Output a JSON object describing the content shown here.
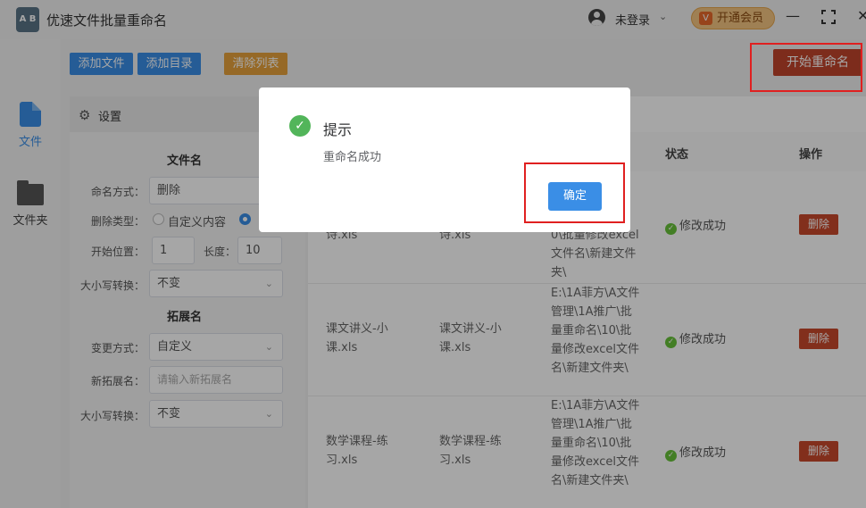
{
  "app": {
    "logo_text": "A B",
    "title": "优速文件批量重命名"
  },
  "header": {
    "user_label": "未登录",
    "user_chevron": "⌄",
    "vip_label": "开通会员",
    "vip_icon_glyph": "V",
    "minimize_glyph": "—",
    "close_glyph": "✕"
  },
  "nav": {
    "files_label": "文件",
    "folders_label": "文件夹"
  },
  "toolbar": {
    "add_file": "添加文件",
    "add_dir": "添加目录",
    "clear_list": "清除列表",
    "start_rename": "开始重命名"
  },
  "settings": {
    "title": "设置",
    "gear_glyph": "⚙",
    "filename_section": "文件名",
    "naming_mode_label": "命名方式：",
    "naming_mode_value": "删除",
    "delete_type_label": "删除类型：",
    "delete_type_option1": "自定义内容",
    "start_pos_label": "开始位置：",
    "start_pos_value": "1",
    "length_label": "长度：",
    "length_value": "10",
    "case_label": "大小写转换：",
    "case_value": "不变",
    "ext_section": "拓展名",
    "change_mode_label": "变更方式：",
    "change_mode_value": "自定义",
    "new_ext_label": "新拓展名：",
    "new_ext_placeholder": "请输入新拓展名",
    "ext_case_label": "大小写转换：",
    "ext_case_value": "不变"
  },
  "table": {
    "columns": {
      "status": "状态",
      "action": "操作"
    },
    "rows": [
      {
        "original_name": "诗.xls",
        "new_name": "诗.xls",
        "path": "0\\批量修改excel文件名\\新建文件夹\\",
        "status": "修改成功",
        "action": "删除"
      },
      {
        "original_name": "课文讲义-小课.xls",
        "new_name": "课文讲义-小课.xls",
        "path": "E:\\1A菲方\\A文件管理\\1A推广\\批量重命名\\10\\批量修改excel文件名\\新建文件夹\\",
        "status": "修改成功",
        "action": "删除"
      },
      {
        "original_name": "数学课程-练习.xls",
        "new_name": "数学课程-练习.xls",
        "path": "E:\\1A菲方\\A文件管理\\1A推广\\批量重命名\\10\\批量修改excel文件名\\新建文件夹\\",
        "status": "修改成功",
        "action": "删除"
      }
    ],
    "partial_top_path": "\\"
  },
  "dialog": {
    "title": "提示",
    "message": "重命名成功",
    "ok_label": "确定",
    "check_glyph": "✓"
  },
  "colors": {
    "primary": "#3a8ee6",
    "warning": "#e6a23c",
    "danger": "#c0442b",
    "success": "#52b55a",
    "highlight_box": "#e02020"
  }
}
